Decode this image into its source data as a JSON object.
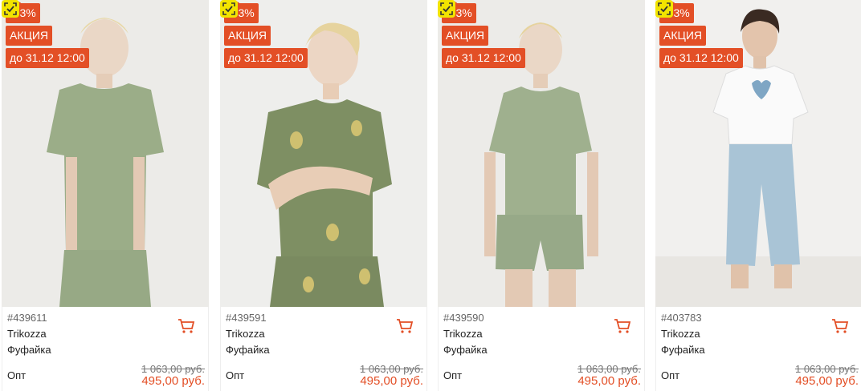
{
  "colors": {
    "accent": "#e34f26",
    "ar_badge": "#f2e400"
  },
  "icons": {
    "favorite": "heart-icon",
    "ar": "scan-check-icon",
    "cart": "cart-icon"
  },
  "products": [
    {
      "discount": "-53%",
      "promo": "АКЦИЯ",
      "deadline": "до 31.12 12:00",
      "sku": "#439611",
      "brand": "Trikozza",
      "name": "Фуфайка",
      "price_type": "Опт",
      "old_price": "1 063,00 руб.",
      "price": "495,00 руб."
    },
    {
      "discount": "-53%",
      "promo": "АКЦИЯ",
      "deadline": "до 31.12 12:00",
      "sku": "#439591",
      "brand": "Trikozza",
      "name": "Фуфайка",
      "price_type": "Опт",
      "old_price": "1 063,00 руб.",
      "price": "495,00 руб."
    },
    {
      "discount": "-53%",
      "promo": "АКЦИЯ",
      "deadline": "до 31.12 12:00",
      "sku": "#439590",
      "brand": "Trikozza",
      "name": "Фуфайка",
      "price_type": "Опт",
      "old_price": "1 063,00 руб.",
      "price": "495,00 руб."
    },
    {
      "discount": "-53%",
      "promo": "АКЦИЯ",
      "deadline": "до 31.12 12:00",
      "sku": "#403783",
      "brand": "Trikozza",
      "name": "Фуфайка",
      "price_type": "Опт",
      "old_price": "1 063,00 руб.",
      "price": "495,00 руб."
    }
  ]
}
